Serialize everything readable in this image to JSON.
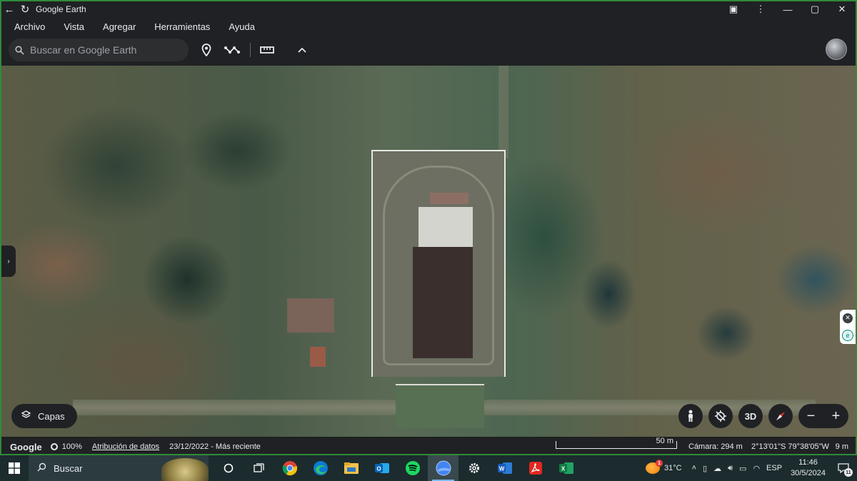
{
  "window": {
    "title": "Google Earth",
    "back_icon": "←",
    "reload_icon": "↻",
    "extensions_icon": "▣",
    "more_icon": "⋮",
    "minimize_icon": "—",
    "maximize_icon": "▢",
    "close_icon": "✕",
    "accent_color": "#2e8b3a"
  },
  "menu": [
    "Archivo",
    "Vista",
    "Agregar",
    "Herramientas",
    "Ayuda"
  ],
  "toolbar": {
    "search_placeholder": "Buscar en Google Earth",
    "search_icon": "search-icon",
    "tools": [
      "placemark-icon",
      "path-icon",
      "ruler-icon",
      "chevron-up-icon"
    ]
  },
  "map_controls": {
    "layers_label": "Capas",
    "threed_label": "3D",
    "zoom_out": "−",
    "zoom_in": "+",
    "left_panel_toggle": "›",
    "side_close": "✕",
    "side_icon": "e"
  },
  "status": {
    "logo": "Google",
    "load_percent": "100%",
    "attribution": "Atribución de datos",
    "imagery_date": "23/12/2022 - Más reciente",
    "scale": "50 m",
    "camera": "Cámara: 294 m",
    "coordinates": "2°13'01\"S 79°38'05\"W",
    "elevation": "9 m"
  },
  "taskbar": {
    "search_label": "Buscar",
    "apps": [
      "task-view",
      "multitask",
      "chrome",
      "edge",
      "file-explorer",
      "outlook",
      "spotify",
      "google-earth",
      "settings",
      "word",
      "acrobat",
      "excel"
    ],
    "weather_badge": "1",
    "temperature": "31°C",
    "language": "ESP",
    "time": "11:46",
    "date": "30/5/2024",
    "notifications": "11"
  }
}
